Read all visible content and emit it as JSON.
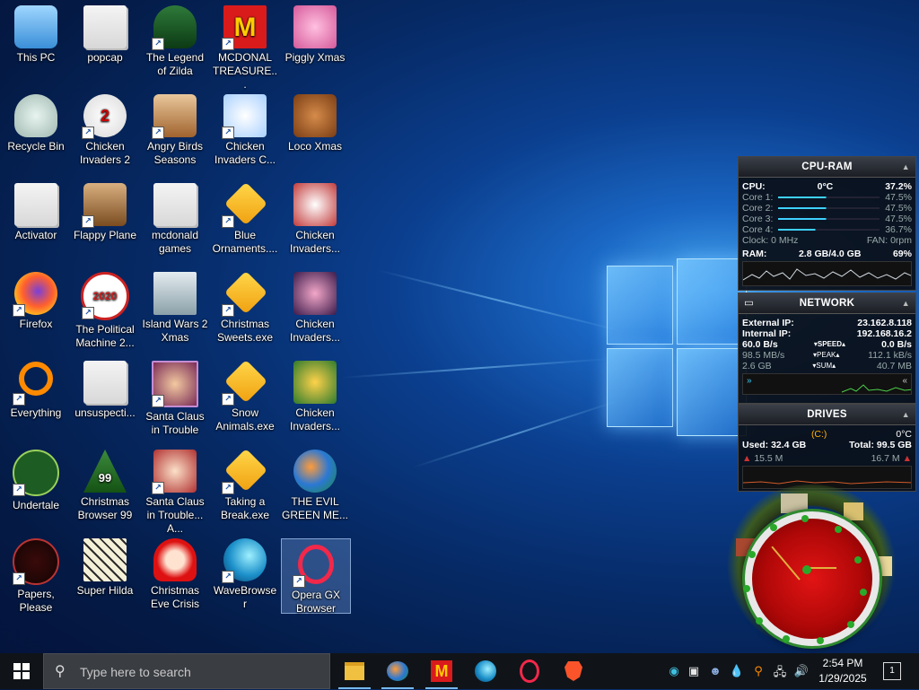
{
  "desktop": {
    "icons": [
      {
        "label": "This PC"
      },
      {
        "label": "popcap"
      },
      {
        "label": "The Legend of Zilda"
      },
      {
        "label": "MCDONAL TREASURE..."
      },
      {
        "label": "Piggly Xmas"
      },
      {
        "label": "Recycle Bin"
      },
      {
        "label": "Chicken Invaders 2"
      },
      {
        "label": "Angry Birds Seasons"
      },
      {
        "label": "Chicken Invaders C..."
      },
      {
        "label": "Loco Xmas"
      },
      {
        "label": "Activator"
      },
      {
        "label": "Flappy Plane"
      },
      {
        "label": "mcdonald games"
      },
      {
        "label": "Blue Ornaments...."
      },
      {
        "label": "Chicken Invaders..."
      },
      {
        "label": "Firefox"
      },
      {
        "label": "The Political Machine 2..."
      },
      {
        "label": "Island Wars 2 Xmas"
      },
      {
        "label": "Christmas Sweets.exe"
      },
      {
        "label": "Chicken Invaders..."
      },
      {
        "label": "Everything"
      },
      {
        "label": "unsuspecti..."
      },
      {
        "label": "Santa Claus in Trouble"
      },
      {
        "label": "Snow Animals.exe"
      },
      {
        "label": "Chicken Invaders..."
      },
      {
        "label": "Undertale"
      },
      {
        "label": "Christmas Browser 99"
      },
      {
        "label": "Santa Claus in Trouble... A..."
      },
      {
        "label": "Taking a Break.exe"
      },
      {
        "label": "THE EVIL GREEN ME..."
      },
      {
        "label": "Papers, Please"
      },
      {
        "label": "Super Hilda"
      },
      {
        "label": "Christmas Eve Crisis"
      },
      {
        "label": "WaveBrowser"
      },
      {
        "label": "Opera GX Browser"
      }
    ],
    "icon_glyphs": {
      "mc": "M",
      "num2020": "2020",
      "num99": "99",
      "num2": "2"
    }
  },
  "cpu_ram": {
    "title": "CPU-RAM",
    "cpu_label": "CPU:",
    "cpu_temp": "0°C",
    "cpu_pct": "37.2%",
    "cores": [
      {
        "label": "Core 1:",
        "pct": "47.5%",
        "level": 0.475
      },
      {
        "label": "Core 2:",
        "pct": "47.5%",
        "level": 0.475
      },
      {
        "label": "Core 3:",
        "pct": "47.5%",
        "level": 0.475
      },
      {
        "label": "Core 4:",
        "pct": "36.7%",
        "level": 0.367
      }
    ],
    "clock": "Clock: 0 MHz",
    "fan": "FAN: 0rpm",
    "ram_label": "RAM:",
    "ram_used": "2.8 GB/4.0 GB",
    "ram_pct": "69%"
  },
  "network": {
    "title": "NETWORK",
    "external_label": "External IP:",
    "external_ip": "23.162.8.118",
    "internal_label": "Internal IP:",
    "internal_ip": "192.168.16.2",
    "speed_down": "60.0 B/s",
    "speed_label": "SPEED",
    "speed_up": "0.0 B/s",
    "peak_down": "98.5 MB/s",
    "peak_label": "PEAK",
    "peak_up": "112.1 kB/s",
    "sum_down": "2.6 GB",
    "sum_label": "SUM",
    "sum_up": "40.7 MB"
  },
  "drives": {
    "title": "DRIVES",
    "drive": "(C:)",
    "temp": "0°C",
    "used": "Used: 32.4 GB",
    "total": "Total: 99.5 GB",
    "read": "15.5 M",
    "write": "16.7 M"
  },
  "taskbar": {
    "search_placeholder": "Type here to search",
    "mc_glyph": "M",
    "time": "2:54 PM",
    "date": "1/29/2025",
    "notifications": "1",
    "accent": "#76b9ed"
  }
}
